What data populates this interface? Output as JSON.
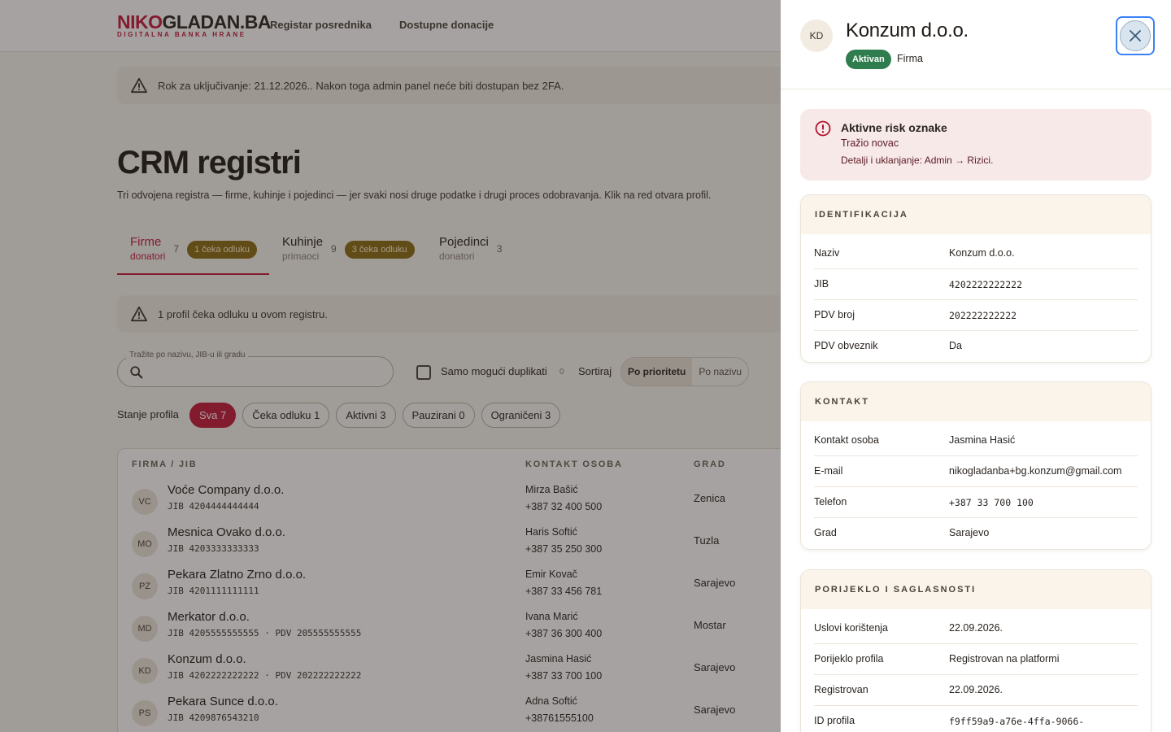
{
  "header": {
    "logo_part1": "NIKO",
    "logo_part2": "GLADAN.BA",
    "logo_sub": "DIGITALNA BANKA HRANE",
    "nav": [
      "Registar posrednika",
      "Dostupne donacije"
    ]
  },
  "banner_2fa": "Rok za uključivanje: 21.12.2026.. Nakon toga admin panel neće biti dostupan bez 2FA.",
  "page": {
    "title": "CRM registri",
    "subtitle": "Tri odvojena registra — firme, kuhinje i pojedinci — jer svaki nosi druge podatke i drugi proces odobravanja. Klik na red otvara profil."
  },
  "tabs": [
    {
      "name": "Firme",
      "role": "donatori",
      "count": "7",
      "badge": "1 čeka odluku",
      "active": true
    },
    {
      "name": "Kuhinje",
      "role": "primaoci",
      "count": "9",
      "badge": "3 čeka odluku",
      "active": false
    },
    {
      "name": "Pojedinci",
      "role": "donatori",
      "count": "3",
      "badge": "",
      "active": false
    }
  ],
  "pending_banner": "1 profil čeka odluku u ovom registru.",
  "search": {
    "label": "Tražite po nazivu, JIB-u ili gradu",
    "value": "",
    "placeholder": ""
  },
  "duplicates": {
    "label": "Samo mogući duplikati",
    "count": "0",
    "checked": false
  },
  "sort": {
    "label": "Sortiraj",
    "options": [
      "Po prioritetu",
      "Po nazivu"
    ],
    "selected": "Po prioritetu"
  },
  "filters": {
    "label": "Stanje profila",
    "chips": [
      "Sva 7",
      "Čeka odluku 1",
      "Aktivni 3",
      "Pauzirani 0",
      "Ograničeni 3"
    ],
    "active": "Sva 7"
  },
  "table": {
    "columns": [
      "FIRMA / JIB",
      "KONTAKT OSOBA",
      "GRAD"
    ],
    "rows": [
      {
        "initials": "VC",
        "name": "Voće Company d.o.o.",
        "jib": "JIB 4204444444444",
        "contact": "Mirza Bašić",
        "phone": "+387 32 400 500",
        "city": "Zenica"
      },
      {
        "initials": "MO",
        "name": "Mesnica Ovako d.o.o.",
        "jib": "JIB 4203333333333",
        "contact": "Haris Softić",
        "phone": "+387 35 250 300",
        "city": "Tuzla"
      },
      {
        "initials": "PZ",
        "name": "Pekara Zlatno Zrno d.o.o.",
        "jib": "JIB 4201111111111",
        "contact": "Emir Kovač",
        "phone": "+387 33 456 781",
        "city": "Sarajevo"
      },
      {
        "initials": "MD",
        "name": "Merkator d.o.o.",
        "jib": "JIB 4205555555555 · PDV 205555555555",
        "contact": "Ivana Marić",
        "phone": "+387 36 300 400",
        "city": "Mostar"
      },
      {
        "initials": "KD",
        "name": "Konzum d.o.o.",
        "jib": "JIB 4202222222222 · PDV 202222222222",
        "contact": "Jasmina Hasić",
        "phone": "+387 33 700 100",
        "city": "Sarajevo"
      },
      {
        "initials": "PS",
        "name": "Pekara Sunce d.o.o.",
        "jib": "JIB 4209876543210",
        "contact": "Adna Softić",
        "phone": "+38761555100",
        "city": "Sarajevo"
      }
    ]
  },
  "drawer": {
    "initials": "KD",
    "title": "Konzum d.o.o.",
    "status": "Aktivan",
    "type": "Firma",
    "risk": {
      "title": "Aktivne risk oznake",
      "flag": "Tražio novac",
      "detail": "Detalji i uklanjanje: Admin → Rizici."
    },
    "sections": [
      {
        "title": "IDENTIFIKACIJA",
        "items": [
          {
            "key": "Naziv",
            "value": "Konzum d.o.o.",
            "mono": false
          },
          {
            "key": "JIB",
            "value": "4202222222222",
            "mono": true
          },
          {
            "key": "PDV broj",
            "value": "202222222222",
            "mono": true
          },
          {
            "key": "PDV obveznik",
            "value": "Da",
            "mono": false
          }
        ]
      },
      {
        "title": "KONTAKT",
        "items": [
          {
            "key": "Kontakt osoba",
            "value": "Jasmina Hasić",
            "mono": false
          },
          {
            "key": "E-mail",
            "value": "nikogladanba+bg.konzum@gmail.com",
            "mono": false
          },
          {
            "key": "Telefon",
            "value": "+387 33 700 100",
            "mono": true
          },
          {
            "key": "Grad",
            "value": "Sarajevo",
            "mono": false
          }
        ]
      },
      {
        "title": "PORIJEKLO I SAGLASNOSTI",
        "items": [
          {
            "key": "Uslovi korištenja",
            "value": "22.09.2026.",
            "mono": false
          },
          {
            "key": "Porijeklo profila",
            "value": "Registrovan na platformi",
            "mono": false
          },
          {
            "key": "Registrovan",
            "value": "22.09.2026.",
            "mono": false
          },
          {
            "key": "ID profila",
            "value": "f9ff59a9-a76e-4ffa-9066-",
            "mono": true
          }
        ]
      }
    ]
  },
  "colors": {
    "brand": "#c4173a",
    "success": "#2f7d4f",
    "warning_badge": "#8a6a10",
    "focus": "#3b82f6"
  }
}
